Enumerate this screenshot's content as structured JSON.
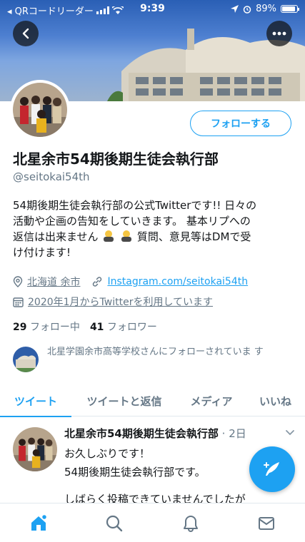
{
  "status_bar": {
    "back_app": "◂ QRコードリーダー",
    "time": "9:39",
    "battery": "89%"
  },
  "icons": {
    "back": "back-arrow-icon",
    "more": "more-dots-icon",
    "location": "location-pin-icon",
    "link": "link-icon",
    "calendar": "calendar-icon",
    "compose": "compose-tweet-icon",
    "home": "home-icon",
    "search": "search-icon",
    "notifications": "bell-icon",
    "messages": "mail-icon"
  },
  "profile": {
    "name": "北星余市54期後期生徒会執行部",
    "handle": "@seitokai54th",
    "follow_label": "フォローする",
    "bio_line1": "54期後期生徒会執行部の公式Twitterです!! 日々の",
    "bio_line2": "活動や企画の告知をしていきます。 基本リプへの",
    "bio_line3a": "返信は出来ません",
    "bio_line3b": "質問、意見等はDMで受",
    "bio_line4": "け付けます!",
    "location": "北海道 余市",
    "link": "Instagram.com/seitokai54th",
    "joined": "2020年1月からTwitterを利用しています",
    "following_count": "29",
    "following_label": "フォロー中",
    "followers_count": "41",
    "followers_label": "フォロワー",
    "followed_by": "北星学園余市高等学校さんにフォローされていま す"
  },
  "tabs": [
    {
      "label": "ツイート",
      "active": true
    },
    {
      "label": "ツイートと返信",
      "active": false
    },
    {
      "label": "メディア",
      "active": false
    },
    {
      "label": "いいね",
      "active": false
    }
  ],
  "tweet": {
    "author": "北星余市54期後期生徒会執行部",
    "time": "· 2日",
    "line1": "お久しぶりです！",
    "line2": "54期後期生徒会執行部です。",
    "line3": "しばらく投稿できていませんでしたが"
  },
  "colors": {
    "accent": "#1da1f2",
    "text": "#14171a",
    "muted": "#657786"
  }
}
